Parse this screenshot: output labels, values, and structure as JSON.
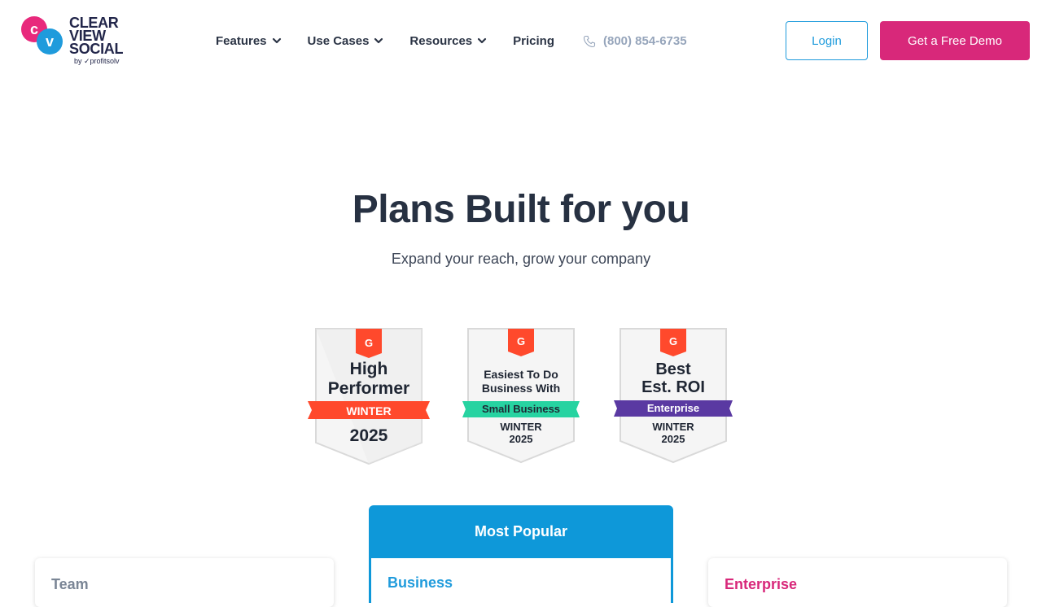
{
  "brand": {
    "logo_c": "c",
    "logo_v": "v",
    "name_line1": "CLEAR",
    "name_line2": "VIEW",
    "name_line3": "SOCIAL",
    "by_text": "by ✓profitsolv"
  },
  "nav": {
    "items": [
      {
        "label": "Features",
        "has_dropdown": true
      },
      {
        "label": "Use Cases",
        "has_dropdown": true
      },
      {
        "label": "Resources",
        "has_dropdown": true
      },
      {
        "label": "Pricing",
        "has_dropdown": false
      }
    ],
    "phone": "(800) 854-6735",
    "login_label": "Login",
    "demo_label": "Get a Free Demo"
  },
  "hero": {
    "title": "Plans Built for you",
    "subtitle": "Expand your reach, grow your company"
  },
  "badges": [
    {
      "line1": "High",
      "line2": "Performer",
      "ribbon": "WINTER",
      "year": "2025",
      "ribbon_color": "#ff492c"
    },
    {
      "line1": "Easiest To Do",
      "line2": "Business With",
      "ribbon": "Small Business",
      "season": "WINTER",
      "year": "2025",
      "ribbon_color": "#27d3a1"
    },
    {
      "line1": "Best",
      "line2": "Est. ROI",
      "ribbon": "Enterprise",
      "season": "WINTER",
      "year": "2025",
      "ribbon_color": "#5a39a2"
    }
  ],
  "pricing": {
    "popular_label": "Most Popular",
    "plans": [
      {
        "name": "Team",
        "color": "#7b8696"
      },
      {
        "name": "Business",
        "color": "#1f9bdc"
      },
      {
        "name": "Enterprise",
        "color": "#d8287a"
      }
    ]
  },
  "colors": {
    "brand_pink": "#d8287a",
    "brand_blue": "#1f9bdc",
    "g2_red": "#ff492c"
  }
}
